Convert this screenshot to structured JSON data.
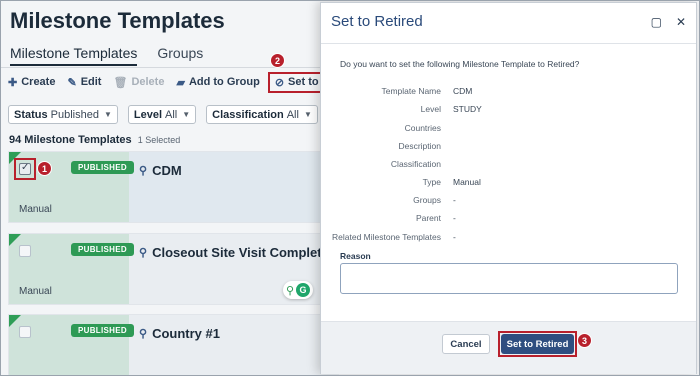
{
  "page": {
    "title": "Milestone Templates",
    "tabs": [
      {
        "label": "Milestone Templates",
        "active": true
      },
      {
        "label": "Groups",
        "active": false
      }
    ]
  },
  "toolbar": {
    "create": "Create",
    "edit": "Edit",
    "delete": "Delete",
    "add_to_group": "Add to Group",
    "set_to_retired": "Set to Retired"
  },
  "filters": [
    {
      "label": "Status",
      "value": "Published"
    },
    {
      "label": "Level",
      "value": "All"
    },
    {
      "label": "Classification",
      "value": "All"
    }
  ],
  "list": {
    "count_text": "94 Milestone Templates",
    "selected_text": "1 Selected",
    "cards": [
      {
        "status": "PUBLISHED",
        "name": "CDM",
        "type": "Manual",
        "checked": true
      },
      {
        "status": "PUBLISHED",
        "name": "Closeout Site Visit Completed",
        "type": "Manual",
        "checked": false
      },
      {
        "status": "PUBLISHED",
        "name": "Country #1",
        "type": "",
        "checked": false
      }
    ]
  },
  "steps": [
    "1",
    "2",
    "3"
  ],
  "floating": {
    "grammarly": "G"
  },
  "modal": {
    "title": "Set to Retired",
    "question": "Do you want to set the following Milestone Template to Retired?",
    "details": [
      {
        "label": "Template Name",
        "value": "CDM"
      },
      {
        "label": "Level",
        "value": "STUDY"
      },
      {
        "label": "Countries",
        "value": ""
      },
      {
        "label": "Description",
        "value": ""
      },
      {
        "label": "Classification",
        "value": ""
      },
      {
        "label": "Type",
        "value": "Manual"
      },
      {
        "label": "Groups",
        "value": "-"
      },
      {
        "label": "Parent",
        "value": "-"
      },
      {
        "label": "Related Milestone Templates",
        "value": "-"
      }
    ],
    "reason_label": "Reason",
    "reason_value": "",
    "cancel_label": "Cancel",
    "confirm_label": "Set to Retired"
  },
  "colors": {
    "published_badge": "#2e9a55",
    "primary_button": "#2f4e80",
    "annotation_red": "#b8202c"
  }
}
